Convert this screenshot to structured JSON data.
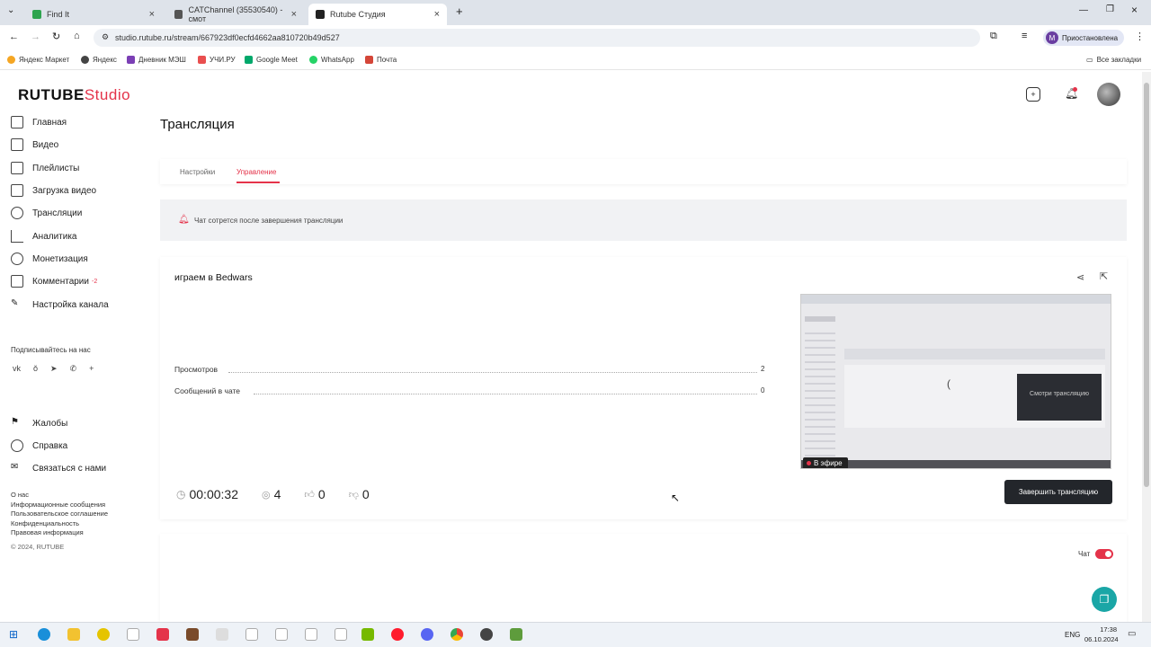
{
  "browser": {
    "tabs": [
      {
        "label": "Find It",
        "color": "#2ea44f"
      },
      {
        "label": "CATChannel (35530540) - смот",
        "color": "#555555"
      },
      {
        "label": "Rutube Студия",
        "color": "#222222"
      }
    ],
    "url": "studio.rutube.ru/stream/667923df0ecfd4662aa810720b49d527",
    "profile": "Приостановлена",
    "profile_initial": "M",
    "bookmarks": [
      "Яндекс Маркет",
      "Яндекс",
      "Дневник МЭШ",
      "УЧИ.РУ",
      "Google Meet",
      "WhatsApp",
      "Почта"
    ],
    "all_bookmarks": "Все закладки"
  },
  "brand": {
    "name": "RUTUBE",
    "suffix": "Studio",
    "accent": "#e4334a"
  },
  "sidebar": {
    "items": [
      "Главная",
      "Видео",
      "Плейлисты",
      "Загрузка видео",
      "Трансляции",
      "Аналитика",
      "Монетизация",
      "Комментарии",
      "Настройка канала"
    ],
    "comments_badge": "-2",
    "subscribe_label": "Подписывайтесь на нас",
    "socials": [
      "vk-icon",
      "ok-icon",
      "telegram-icon",
      "viber-icon",
      "plus-icon"
    ],
    "help_items": [
      "Жалобы",
      "Справка",
      "Связаться с нами"
    ],
    "footer_links": [
      "О нас",
      "Информационные сообщения",
      "Пользовательское соглашение",
      "Конфиденциальность",
      "Правовая информация"
    ],
    "copyright": "© 2024, RUTUBE"
  },
  "main": {
    "title": "Трансляция",
    "tabs": [
      "Настройки",
      "Управление"
    ],
    "active_tab": 1,
    "notice": "Чат сотрется после завершения трансляции",
    "stream": {
      "name": "играем в Bedwars",
      "stats": [
        {
          "label": "Просмотров",
          "value": "2"
        },
        {
          "label": "Сообщений в чате",
          "value": "0"
        }
      ],
      "duration": "00:00:32",
      "viewers": "4",
      "likes": "0",
      "dislikes": "0",
      "live_badge": "В эфире",
      "preview_overlay": "Смотри трансляцию",
      "end_button": "Завершить трансляцию"
    },
    "chat_toggle_label": "Чат",
    "chat_enabled": true
  },
  "taskbar": {
    "lang": "ENG",
    "time": "17:38",
    "date": "06.10.2024"
  }
}
